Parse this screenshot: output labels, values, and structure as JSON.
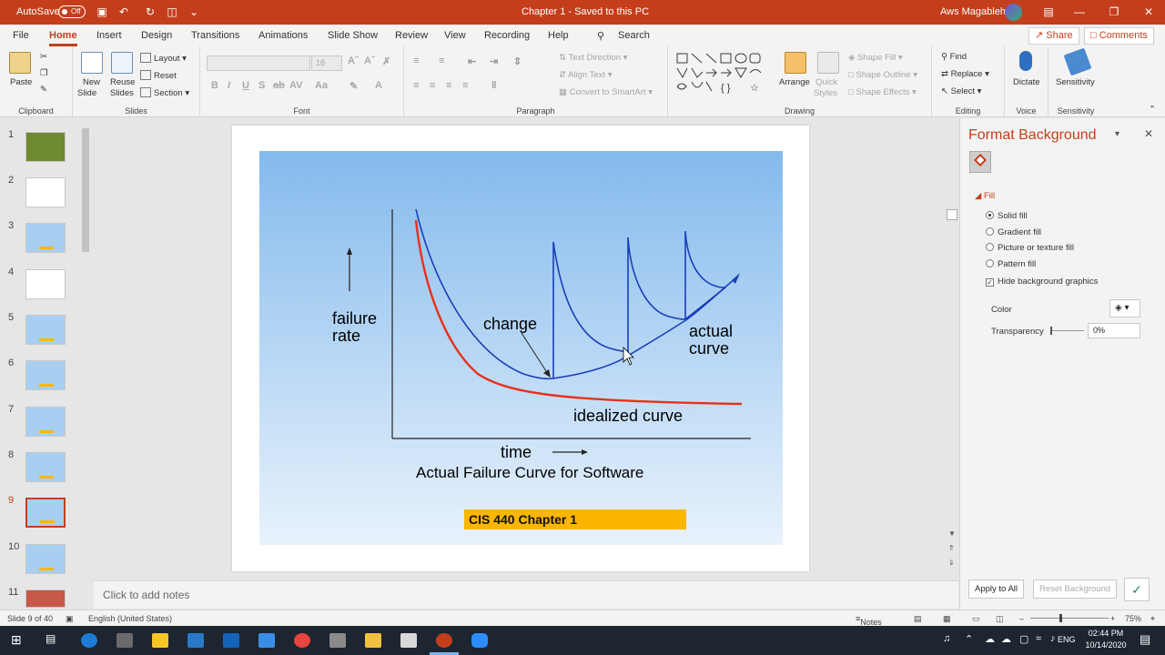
{
  "titlebar": {
    "autosave_label": "AutoSave",
    "autosave_state": "Off",
    "doc_title": "Chapter 1  -  Saved to this PC",
    "user_name": "Aws Magableh",
    "bg": "#c43e1c"
  },
  "menu": {
    "tabs": [
      "File",
      "Home",
      "Insert",
      "Design",
      "Transitions",
      "Animations",
      "Slide Show",
      "Review",
      "View",
      "Recording",
      "Help"
    ],
    "active": "Home",
    "search": "Search",
    "share": "Share",
    "comments": "Comments"
  },
  "ribbon": {
    "clipboard": {
      "label": "Clipboard",
      "paste": "Paste"
    },
    "slides": {
      "label": "Slides",
      "new_slide": "New",
      "new_slide2": "Slide",
      "reuse": "Reuse",
      "reuse2": "Slides",
      "layout": "Layout",
      "reset": "Reset",
      "section": "Section"
    },
    "font": {
      "label": "Font",
      "size": "18"
    },
    "paragraph": {
      "label": "Paragraph",
      "text_direction": "Text Direction",
      "align_text": "Align Text",
      "convert": "Convert to SmartArt"
    },
    "drawing": {
      "label": "Drawing",
      "arrange": "Arrange",
      "quick_styles": "Quick",
      "quick_styles2": "Styles",
      "shape_fill": "Shape Fill",
      "shape_outline": "Shape Outline",
      "shape_effects": "Shape Effects"
    },
    "editing": {
      "label": "Editing",
      "find": "Find",
      "replace": "Replace",
      "select": "Select"
    },
    "voice": {
      "label": "Voice",
      "dictate": "Dictate"
    },
    "sensitivity": {
      "label": "Sensitivity",
      "btn": "Sensitivity"
    }
  },
  "slides_panel": {
    "thumbs": [
      {
        "num": "1",
        "color": "#6e8a2e"
      },
      {
        "num": "2",
        "color": "#ffffff"
      },
      {
        "num": "3",
        "color": "#a8cff2"
      },
      {
        "num": "4",
        "color": "#ffffff"
      },
      {
        "num": "5",
        "color": "#a8cff2"
      },
      {
        "num": "6",
        "color": "#a8cff2"
      },
      {
        "num": "7",
        "color": "#a8cff2"
      },
      {
        "num": "8",
        "color": "#a8cff2"
      },
      {
        "num": "9",
        "color": "#a8cff2"
      },
      {
        "num": "10",
        "color": "#a8cff2"
      },
      {
        "num": "11",
        "color": "#c8584a"
      }
    ],
    "selected": "9"
  },
  "slide": {
    "ylabel1": "failure",
    "ylabel2": "rate",
    "change_label": "change",
    "actual1": "actual",
    "actual2": "curve",
    "idealized": "idealized curve",
    "time": "time",
    "caption": "Actual Failure Curve for Software",
    "banner": "CIS 440 Chapter 1",
    "banner_color": "#fbb600"
  },
  "chart_data": {
    "type": "line",
    "title": "Actual Failure Curve for Software",
    "xlabel": "time",
    "ylabel": "failure rate",
    "series": [
      {
        "name": "idealized curve",
        "color": "#e8301c"
      },
      {
        "name": "actual curve",
        "color": "#1a3fb8"
      }
    ],
    "annotations": [
      "change"
    ]
  },
  "notes": {
    "placeholder": "Click to add notes"
  },
  "format_pane": {
    "title": "Format Background",
    "section": "Fill",
    "options": [
      "Solid fill",
      "Gradient fill",
      "Picture or texture fill",
      "Pattern fill"
    ],
    "selected": "Solid fill",
    "hide_bg": "Hide background graphics",
    "color_label": "Color",
    "transparency_label": "Transparency",
    "transparency_value": "0%",
    "apply_all": "Apply to All",
    "reset_bg": "Reset Background"
  },
  "status": {
    "slide_info": "Slide 9 of 40",
    "language": "English (United States)",
    "notes": "Notes",
    "zoom": "75%"
  },
  "taskbar": {
    "lang": "ENG",
    "time": "02:44 PM",
    "date": "10/14/2020"
  }
}
